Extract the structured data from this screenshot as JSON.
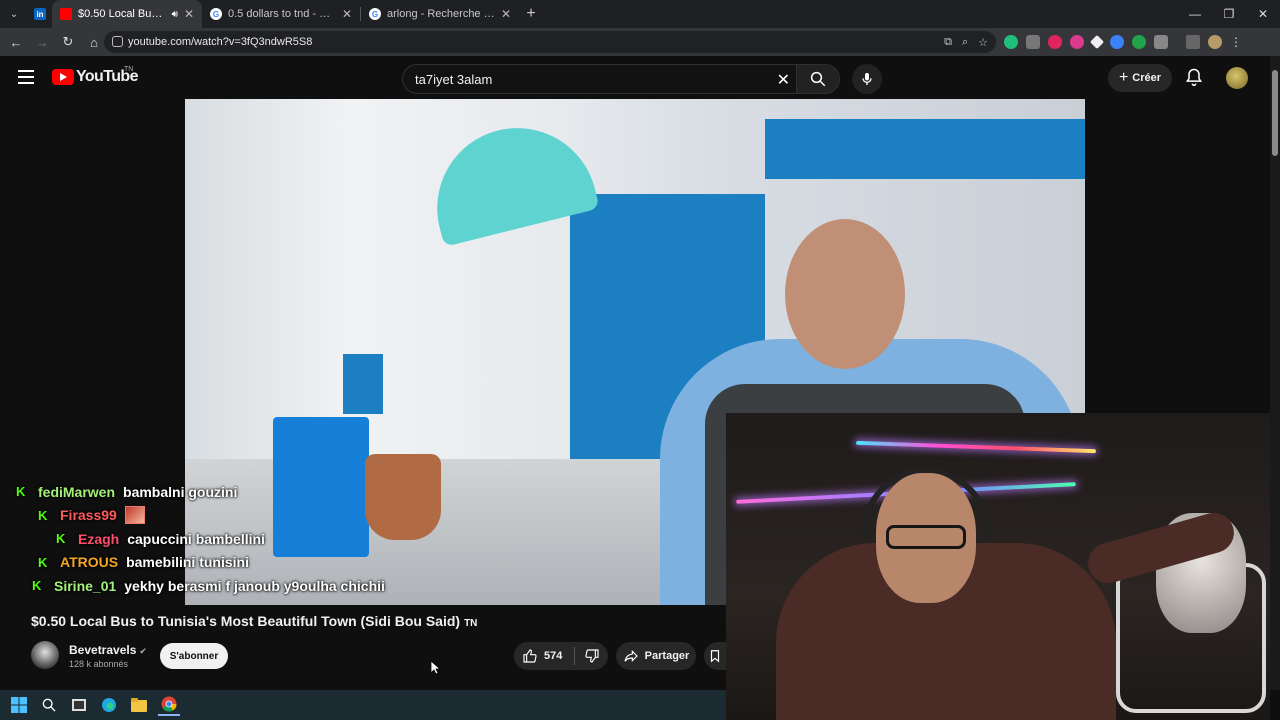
{
  "browser": {
    "tabs": [
      {
        "title": "",
        "icon": "linkedin-icon",
        "pinned": true
      },
      {
        "title": "$0.50 Local Bus to Tunisia's",
        "icon": "youtube-icon",
        "active": true,
        "audio": true
      },
      {
        "title": "0.5 dollars to tnd - Recherche G",
        "icon": "google-icon"
      },
      {
        "title": "arlong - Recherche Google",
        "icon": "google-icon"
      }
    ],
    "url": "youtube.com/watch?v=3fQ3ndwR5S8"
  },
  "youtube": {
    "logo_text": "YouTube",
    "country_code": "TN",
    "search_value": "ta7iyet 3alam",
    "create_label": "Créer"
  },
  "chat": [
    {
      "user": "fediMarwen",
      "color": "#a4f07a",
      "message": "bambalni gouzini",
      "indent": 0
    },
    {
      "user": "Firass99",
      "color": "#ff5a5a",
      "message": "",
      "emote": true,
      "indent": 1
    },
    {
      "user": "Ezagh",
      "color": "#ff4d6d",
      "message": "capuccini bambellini",
      "indent": 2
    },
    {
      "user": "ATROUS",
      "color": "#f5a623",
      "message": "bamebilini tunisini",
      "indent": 1
    },
    {
      "user": "Sirine_01",
      "color": "#a4f07a",
      "message": "yekhy berasmi f janoub y9oulha chichii",
      "indent": 1
    }
  ],
  "video": {
    "title": "$0.50 Local Bus to Tunisia's Most Beautiful Town (Sidi Bou Said)",
    "title_suffix": "TN",
    "channel": "Bevetravels",
    "subscribers": "128 k abonnés",
    "subscribe_label": "S'abonner",
    "likes": "574",
    "share_label": "Partager"
  },
  "colors": {
    "kick_green": "#53fc18",
    "youtube_red": "#ff0000",
    "background": "#0f0f0f"
  }
}
